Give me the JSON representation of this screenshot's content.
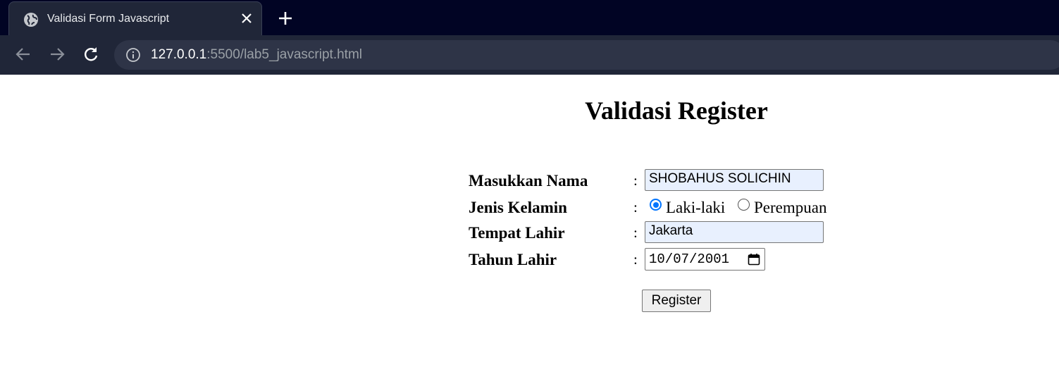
{
  "browser": {
    "tab_title": "Validasi Form Javascript",
    "url_host": "127.0.0.1",
    "url_rest": ":5500/lab5_javascript.html"
  },
  "page": {
    "title": "Validasi Register",
    "colon": ":",
    "fields": {
      "nama": {
        "label": "Masukkan Nama",
        "value": "SHOBAHUS SOLICHIN"
      },
      "jenis_kelamin": {
        "label": "Jenis Kelamin",
        "options": [
          "Laki-laki",
          "Perempuan"
        ],
        "selected": "Laki-laki"
      },
      "tempat_lahir": {
        "label": "Tempat Lahir",
        "value": "Jakarta"
      },
      "tahun_lahir": {
        "label": "Tahun Lahir",
        "value": "10/07/2001"
      }
    },
    "register_label": "Register"
  },
  "colors": {
    "chrome_bg": "#010424",
    "toolbar_bg": "#202638",
    "autofill_bg": "#e8f0fe",
    "radio_accent": "#0075ff"
  }
}
